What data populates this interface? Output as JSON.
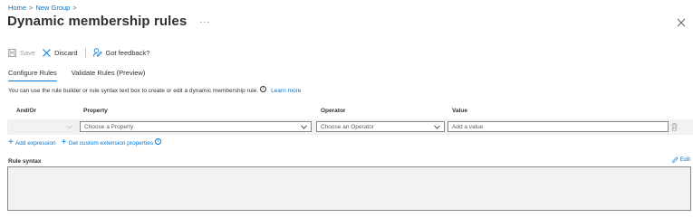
{
  "breadcrumb": {
    "items": [
      "Home",
      "New Group"
    ],
    "separator": ">"
  },
  "header": {
    "title": "Dynamic membership rules",
    "more_label": "···"
  },
  "toolbar": {
    "save_label": "Save",
    "discard_label": "Discard",
    "feedback_label": "Got feedback?"
  },
  "tabs": [
    {
      "label": "Configure Rules",
      "active": true
    },
    {
      "label": "Validate Rules (Preview)",
      "active": false
    }
  ],
  "description": {
    "text": "You can use the rule builder or rule syntax text box to create or edit a dynamic membership rule.",
    "info_glyph": "i",
    "learn_more": "Learn more"
  },
  "rule_table": {
    "columns": [
      "And/Or",
      "Property",
      "Operator",
      "Value"
    ],
    "row": {
      "and_or": "",
      "property_placeholder": "Choose a Property",
      "operator_placeholder": "Choose an Operator",
      "value_placeholder": "Add a value"
    }
  },
  "actions": {
    "add_expression": "Add expression",
    "get_custom_extension": "Get custom extension properties",
    "plus_glyph": "+"
  },
  "rule_syntax": {
    "label": "Rule syntax",
    "edit_label": "Edit",
    "value": ""
  },
  "colors": {
    "accent": "#0078d4",
    "text": "#323130",
    "disabled": "#a19f9d",
    "field_border": "#8a8886",
    "panel_bg": "#f3f2f1"
  }
}
